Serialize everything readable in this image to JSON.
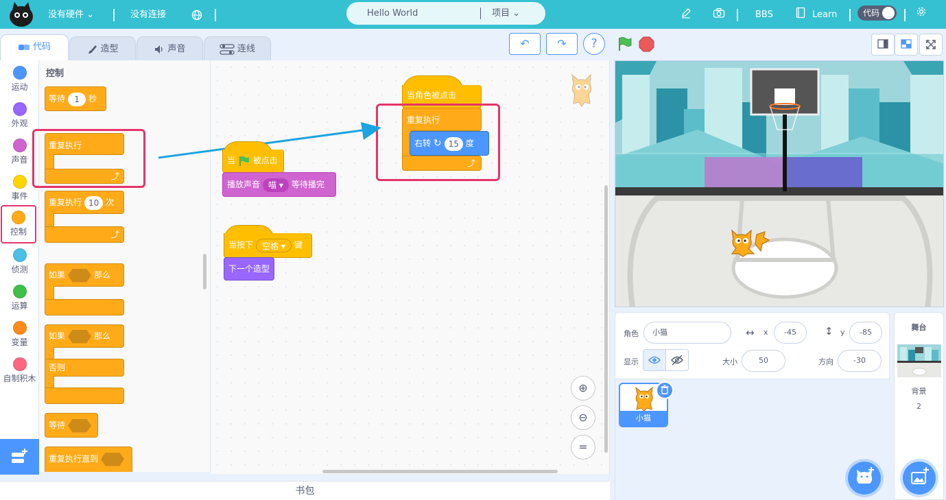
{
  "topbar": {
    "hardware": "没有硬件",
    "connection": "没有连接",
    "project_name": "Hello World",
    "project_menu": "项目",
    "bbs": "BBS",
    "learn": "Learn",
    "code_toggle": "代码"
  },
  "tabs": [
    {
      "label": "代码",
      "icon": "code-icon"
    },
    {
      "label": "造型",
      "icon": "brush-icon"
    },
    {
      "label": "声音",
      "icon": "speaker-icon"
    },
    {
      "label": "连线",
      "icon": "wiring-icon"
    }
  ],
  "categories": [
    {
      "label": "运动",
      "color": "#4c97ff"
    },
    {
      "label": "外观",
      "color": "#9966ff"
    },
    {
      "label": "声音",
      "color": "#cf63cf"
    },
    {
      "label": "事件",
      "color": "#ffd500"
    },
    {
      "label": "控制",
      "color": "#ffab19"
    },
    {
      "label": "侦测",
      "color": "#4cbfe6"
    },
    {
      "label": "运算",
      "color": "#40bf4a"
    },
    {
      "label": "变量",
      "color": "#ff8c1a"
    },
    {
      "label": "自制积木",
      "color": "#ff6680"
    }
  ],
  "palette": {
    "title": "控制",
    "wait": {
      "label": "等待",
      "value": "1",
      "unit": "秒"
    },
    "forever": "重复执行",
    "repeat": {
      "label": "重复执行",
      "value": "10",
      "unit": "次"
    },
    "if_then": {
      "if": "如果",
      "then": "那么"
    },
    "if_else": {
      "if": "如果",
      "then": "那么",
      "else": "否则"
    },
    "wait_until": "等待",
    "repeat_until": "重复执行直到"
  },
  "workspace": {
    "script1": {
      "hat": "当角色被点击",
      "forever": "重复执行",
      "turn": "右转",
      "degrees": "15",
      "deg_unit": "度"
    },
    "script2": {
      "hat_pre": "当",
      "hat_post": "被点击",
      "sound": "播放声音",
      "sound_name": "喵",
      "sound_post": "等待播完"
    },
    "script3": {
      "hat_pre": "当按下",
      "key": "空格",
      "hat_post": "键",
      "next": "下一个造型"
    }
  },
  "bag": "书包",
  "sprite_info": {
    "sprite_label": "角色",
    "sprite_name": "小猫",
    "x_label": "x",
    "x": "-45",
    "y_label": "y",
    "y": "-85",
    "show_label": "显示",
    "size_label": "大小",
    "size": "50",
    "direction_label": "方向",
    "direction": "-30"
  },
  "sprites": [
    {
      "name": "小猫"
    }
  ],
  "stage_panel": {
    "title": "舞台",
    "backdrop_label": "背景",
    "backdrop_count": "2"
  }
}
